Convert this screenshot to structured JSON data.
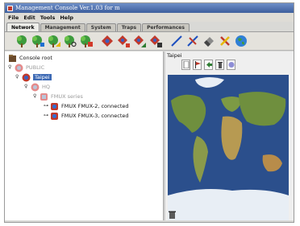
{
  "window": {
    "title": "Management Console Ver.1.03 for m"
  },
  "menu": [
    {
      "label": "File"
    },
    {
      "label": "Edit"
    },
    {
      "label": "Tools"
    },
    {
      "label": "Help"
    }
  ],
  "tabs": [
    {
      "label": "Network",
      "active": true
    },
    {
      "label": "Management",
      "active": false
    },
    {
      "label": "System",
      "active": false
    },
    {
      "label": "Traps",
      "active": false
    },
    {
      "label": "Performances",
      "active": false
    }
  ],
  "toolbar": {
    "buttons": [
      {
        "icon": "tree-icon"
      },
      {
        "icon": "tree-add-icon"
      },
      {
        "icon": "tree-edit-icon"
      },
      {
        "icon": "tree-find-icon"
      },
      {
        "icon": "tree-delete-icon"
      },
      {
        "icon": "node-icon"
      },
      {
        "icon": "node-add-icon"
      },
      {
        "icon": "node-edit-icon"
      },
      {
        "icon": "node-delete-icon"
      },
      {
        "icon": "link-icon"
      },
      {
        "icon": "link-cross-icon"
      },
      {
        "icon": "eraser-icon"
      },
      {
        "icon": "tools-icon"
      },
      {
        "icon": "globe-icon"
      }
    ]
  },
  "tree": {
    "root": {
      "label": "Console root"
    },
    "nodes": [
      {
        "label": "PUBLIC",
        "muted": true
      },
      {
        "label": "Taipei",
        "muted": false,
        "selected": true
      },
      {
        "label": "HQ",
        "muted": true
      },
      {
        "label": "FMUX series",
        "muted": true
      },
      {
        "label": "FMUX FMUX-2, connected",
        "muted": false
      },
      {
        "label": "FMUX FMUX-3, connected",
        "muted": false
      }
    ]
  },
  "detail": {
    "title": "Taipei",
    "tool_icons": [
      "page-icon",
      "flag-icon",
      "arrow-icon",
      "bin-icon",
      "paint-icon"
    ]
  },
  "colors": {
    "title_bar": "#4e6fb0",
    "selection": "#3f6bb5",
    "device_red": "#c0392b",
    "map_ocean": "#2b4f8c"
  }
}
